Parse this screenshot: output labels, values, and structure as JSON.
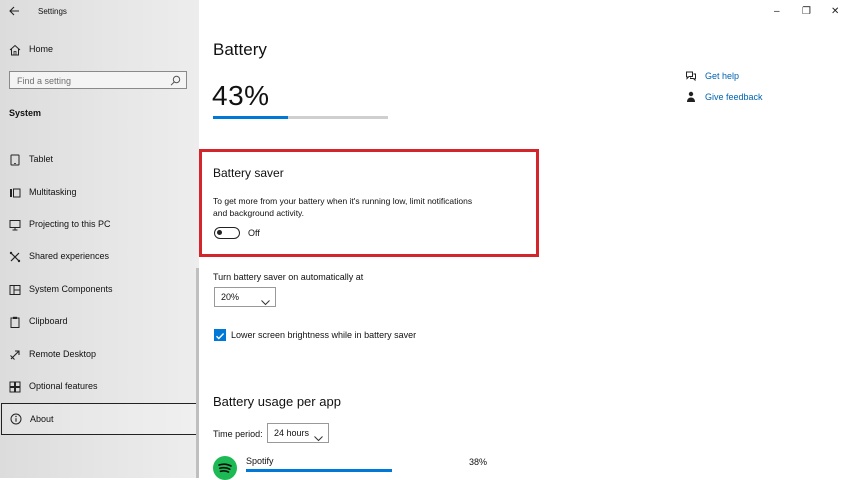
{
  "window": {
    "title": "Settings",
    "minimize": "–",
    "restore": "❐",
    "close": "✕"
  },
  "sidebar": {
    "home_label": "Home",
    "search_placeholder": "Find a setting",
    "section_title": "System",
    "items": [
      {
        "label": "Tablet",
        "icon": "tablet-icon"
      },
      {
        "label": "Multitasking",
        "icon": "multitasking-icon"
      },
      {
        "label": "Projecting to this PC",
        "icon": "projecting-icon"
      },
      {
        "label": "Shared experiences",
        "icon": "shared-experiences-icon"
      },
      {
        "label": "System Components",
        "icon": "system-components-icon"
      },
      {
        "label": "Clipboard",
        "icon": "clipboard-icon"
      },
      {
        "label": "Remote Desktop",
        "icon": "remote-desktop-icon"
      },
      {
        "label": "Optional features",
        "icon": "optional-features-icon"
      },
      {
        "label": "About",
        "icon": "about-icon"
      }
    ],
    "selected": "About"
  },
  "main": {
    "title": "Battery",
    "battery_percent_label": "43%",
    "battery_level": 0.43,
    "saver": {
      "title": "Battery saver",
      "description_line1": "To get more from your battery when it's running low, limit notifications",
      "description_line2": "and background activity.",
      "toggle_state": "Off"
    },
    "auto_on": {
      "label": "Turn battery saver on automatically at",
      "value": "20%"
    },
    "lower_brightness": {
      "label": "Lower screen brightness while in battery saver",
      "checked": true
    },
    "usage": {
      "title": "Battery usage per app",
      "time_period_label": "Time period:",
      "time_period_value": "24 hours",
      "apps": [
        {
          "name": "Spotify",
          "percent_label": "38%",
          "level": 0.38
        }
      ]
    },
    "help": {
      "get_help": "Get help",
      "give_feedback": "Give feedback"
    }
  },
  "colors": {
    "accent": "#0078d7",
    "highlight_box": "#d4252a",
    "link": "#0063b1",
    "spotify": "#1db954"
  }
}
